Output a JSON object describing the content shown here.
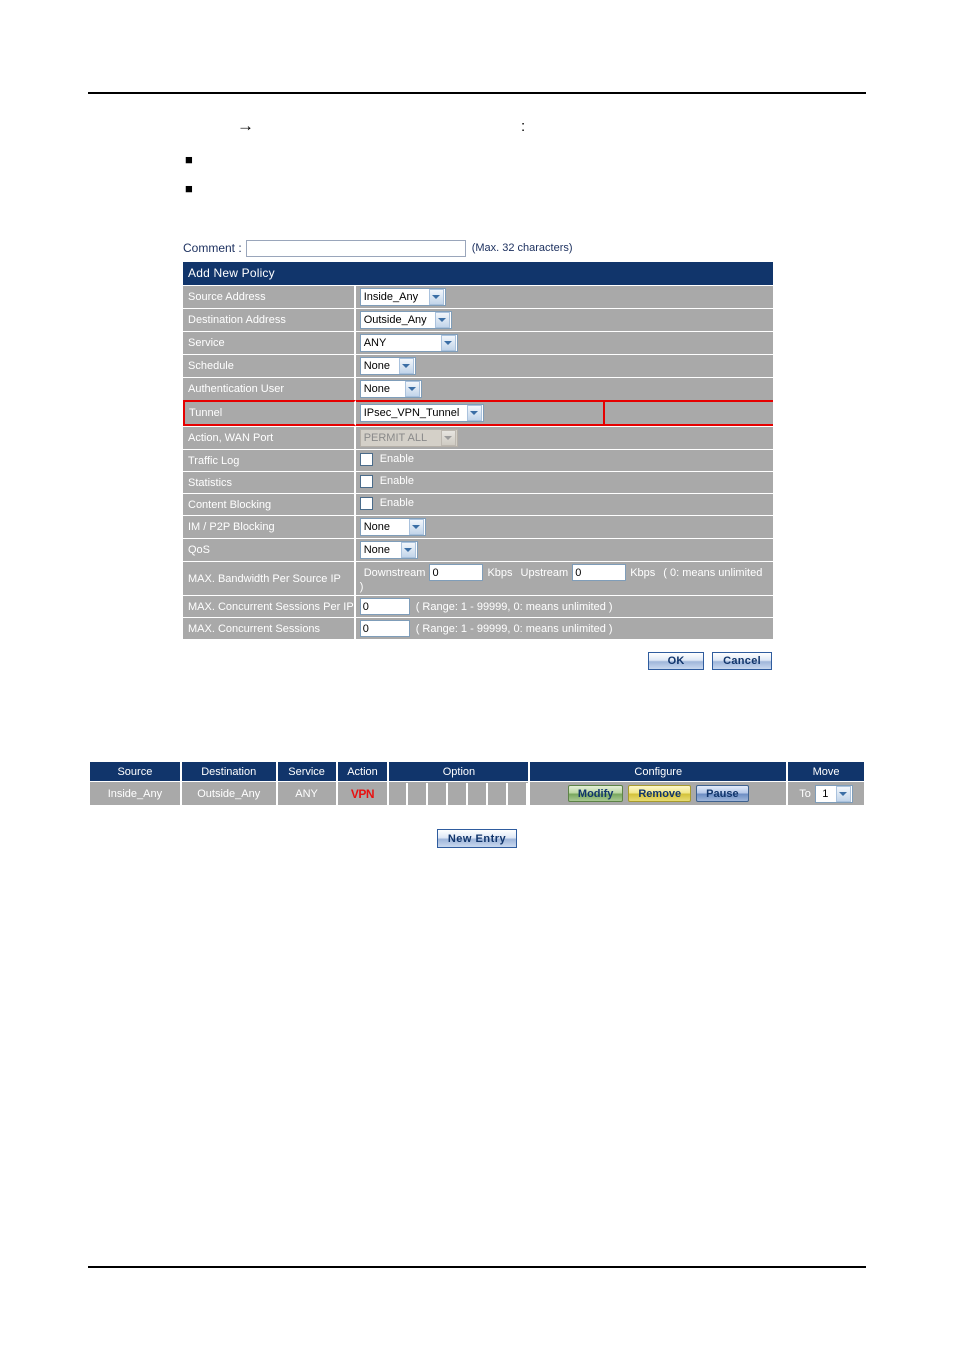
{
  "document": {
    "arrow_marker": "→",
    "colon_marker": ":",
    "bullet_marker": "■",
    "bullet_marker_2": "■"
  },
  "policy_form": {
    "comment": {
      "label": "Comment :",
      "value": "",
      "placeholder": "",
      "hint": "(Max. 32 characters)"
    },
    "title": "Add New Policy",
    "rows": [
      {
        "label": "Source Address",
        "type": "select",
        "value": "Inside_Any"
      },
      {
        "label": "Destination Address",
        "type": "select",
        "value": "Outside_Any"
      },
      {
        "label": "Service",
        "type": "select",
        "value": "ANY"
      },
      {
        "label": "Schedule",
        "type": "select",
        "value": "None"
      },
      {
        "label": "Authentication User",
        "type": "select",
        "value": "None"
      },
      {
        "label": "Tunnel",
        "type": "select",
        "value": "IPsec_VPN_Tunnel",
        "highlighted": true
      },
      {
        "label": "Action, WAN Port",
        "type": "select",
        "value": "PERMIT ALL",
        "disabled": true
      },
      {
        "label": "Traffic Log",
        "type": "checkbox",
        "value": "Enable",
        "checked": false
      },
      {
        "label": "Statistics",
        "type": "checkbox",
        "value": "Enable",
        "checked": false
      },
      {
        "label": "Content Blocking",
        "type": "checkbox",
        "value": "Enable",
        "checked": false
      },
      {
        "label": "IM / P2P Blocking",
        "type": "select",
        "value": "None"
      },
      {
        "label": "QoS",
        "type": "select",
        "value": "None"
      },
      {
        "label": "MAX. Bandwidth Per Source IP",
        "type": "bandwidth"
      },
      {
        "label": "MAX. Concurrent Sessions Per IP",
        "type": "sessions",
        "value": "0",
        "hint": "( Range: 1 - 99999, 0: means unlimited )"
      },
      {
        "label": "MAX. Concurrent Sessions",
        "type": "sessions",
        "value": "0",
        "hint": "( Range: 1 - 99999, 0: means unlimited )"
      }
    ],
    "bandwidth": {
      "downstream_label": "Downstream",
      "downstream_value": "0",
      "kbps_label_1": "Kbps",
      "upstream_label": "Upstream",
      "upstream_value": "0",
      "kbps_label_2": "Kbps",
      "hint": "( 0: means unlimited )"
    },
    "buttons": {
      "ok": "OK",
      "cancel": "Cancel"
    },
    "highlight_color": "#e60000",
    "header_color": "#11356b",
    "row_color": "#a9a9a9"
  },
  "policy_list": {
    "headers": [
      "Source",
      "Destination",
      "Service",
      "Action",
      "Option",
      "Configure",
      "Move"
    ],
    "row": {
      "source": "Inside_Any",
      "destination": "Outside_Any",
      "service": "ANY",
      "action_badge": "VPN",
      "action_badge_color": "#e81111",
      "option_cell_count": 7,
      "configure": {
        "modify": "Modify",
        "remove": "Remove",
        "pause": "Pause"
      },
      "move": {
        "label": "To",
        "value": "1"
      }
    },
    "new_entry": "New Entry"
  }
}
